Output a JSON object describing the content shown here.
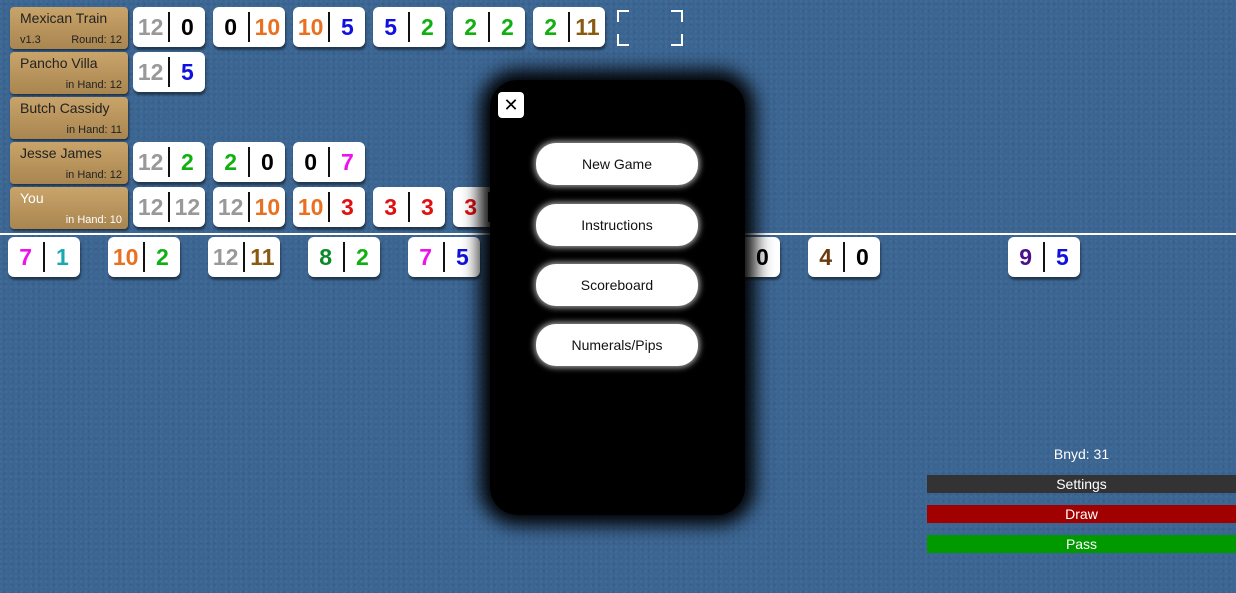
{
  "colors": {
    "0": "#000000",
    "1": "#1aa9b0",
    "2": "#10b010",
    "3": "#e01010",
    "4": "#6b3a10",
    "5": "#1010e0",
    "7": "#ee10ee",
    "8": "#0a8a2a",
    "9": "#4b108c",
    "10": "#e87020",
    "11": "#8a5a10",
    "12": "#999999"
  },
  "players": [
    {
      "name": "Mexican Train",
      "version": "v1.3",
      "status": "Round: 12",
      "tiles": [
        [
          12,
          0
        ],
        [
          0,
          10
        ],
        [
          10,
          5
        ],
        [
          5,
          2
        ],
        [
          2,
          2
        ],
        [
          2,
          11
        ]
      ]
    },
    {
      "name": "Pancho Villa",
      "status": "in Hand: 12",
      "tiles": [
        [
          12,
          5
        ]
      ]
    },
    {
      "name": "Butch Cassidy",
      "status": "in Hand: 11",
      "tiles": []
    },
    {
      "name": "Jesse James",
      "status": "in Hand: 12",
      "tiles": [
        [
          12,
          2
        ],
        [
          2,
          0
        ],
        [
          0,
          7
        ]
      ]
    },
    {
      "name": "You",
      "status": "in Hand: 10",
      "tiles": [
        [
          12,
          12
        ],
        [
          12,
          10
        ],
        [
          10,
          3
        ],
        [
          3,
          3
        ],
        [
          3,
          ""
        ]
      ]
    }
  ],
  "hand": [
    [
      7,
      1
    ],
    [
      10,
      2
    ],
    [
      12,
      11
    ],
    [
      8,
      2
    ],
    [
      7,
      5
    ],
    null,
    null,
    [
      "",
      0
    ],
    [
      4,
      0
    ],
    null,
    [
      9,
      5
    ]
  ],
  "menu": {
    "close": "✕",
    "items": [
      "New Game",
      "Instructions",
      "Scoreboard",
      "Numerals/Pips"
    ]
  },
  "panel": {
    "boneyard": "Bnyd: 31",
    "settings": "Settings",
    "draw": "Draw",
    "pass": "Pass",
    "settings_color": "#333333",
    "draw_color": "#a00000",
    "pass_color": "#009900"
  }
}
